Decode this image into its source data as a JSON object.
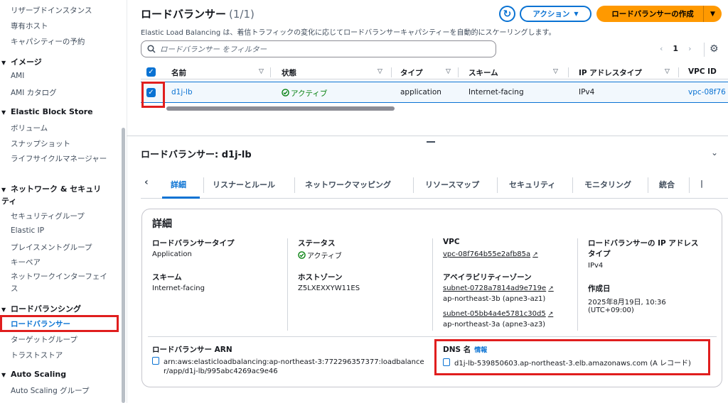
{
  "sidebar": {
    "items_top": [
      "リザーブドインスタンス",
      "専有ホスト",
      "キャパシティーの予約"
    ],
    "images_head": "イメージ",
    "images_items": [
      "AMI",
      "AMI カタログ"
    ],
    "ebs_head": "Elastic Block Store",
    "ebs_items": [
      "ボリューム",
      "スナップショット",
      "ライフサイクルマネージャー"
    ],
    "network_head": "ネットワーク & セキュリティ",
    "network_items": [
      "セキュリティグループ",
      "Elastic IP",
      "プレイスメントグループ",
      "キーペア",
      "ネットワークインターフェイス"
    ],
    "lb_head": "ロードバランシング",
    "lb_items": [
      "ロードバランサー",
      "ターゲットグループ",
      "トラストストア"
    ],
    "as_head": "Auto Scaling",
    "as_items": [
      "Auto Scaling グループ"
    ]
  },
  "header": {
    "title": "ロードバランサー",
    "count": "(1/1)",
    "subtitle": "Elastic Load Balancing は、着信トラフィックの変化に応じてロードバランサーキャパシティーを自動的にスケーリングします。",
    "action_label": "アクション",
    "create_label": "ロードバランサーの作成"
  },
  "filter": {
    "placeholder": "ロードバランサー をフィルター"
  },
  "pager": {
    "prev": "‹",
    "page": "1",
    "next": "›"
  },
  "table": {
    "columns": [
      "名前",
      "状態",
      "タイプ",
      "スキーム",
      "IP アドレスタイプ",
      "VPC ID"
    ],
    "row": {
      "name": "d1j-lb",
      "state": "アクティブ",
      "type": "application",
      "scheme": "Internet-facing",
      "ip_type": "IPv4",
      "vpc": "vpc-08f76"
    }
  },
  "detail": {
    "title": "ロードバランサー: d1j-lb",
    "tabs": [
      "詳細",
      "リスナーとルール",
      "ネットワークマッピング",
      "リソースマップ",
      "セキュリティ",
      "モニタリング",
      "統合"
    ],
    "card_title": "詳細",
    "lb_type_key": "ロードバランサータイプ",
    "lb_type_val": "Application",
    "scheme_key": "スキーム",
    "scheme_val": "Internet-facing",
    "status_key": "ステータス",
    "status_val": "アクティブ",
    "hosted_zone_key": "ホストゾーン",
    "hosted_zone_val": "Z5LXEXXYW11ES",
    "vpc_key": "VPC",
    "vpc_val": "vpc-08f764b55e2afb85a",
    "az_key": "アベイラビリティーゾーン",
    "subnet1": "subnet-0728a7814ad9e719e",
    "subnet1_az": "ap-northeast-3b (apne3-az1)",
    "subnet2": "subnet-05bb4a4e5781c30d5",
    "subnet2_az": "ap-northeast-3a (apne3-az3)",
    "ip_type_key_1": "ロードバランサーの IP アドレス",
    "ip_type_key_2": "タイプ",
    "ip_type_val": "IPv4",
    "created_key": "作成日",
    "created_val_1": "2025年8月19日, 10:36",
    "created_val_2": "(UTC+09:00)",
    "arn_key": "ロードバランサー ARN",
    "arn_val_1": "arn:aws:elasticloadbalancing:ap-northeast-3:772296357377:loadbalance",
    "arn_val_2": "r/app/d1j-lb/995abc4269ac9e46",
    "dns_key": "DNS 名",
    "dns_info": "情報",
    "dns_val": "d1j-lb-539850603.ap-northeast-3.elb.amazonaws.com (A レコード)"
  }
}
